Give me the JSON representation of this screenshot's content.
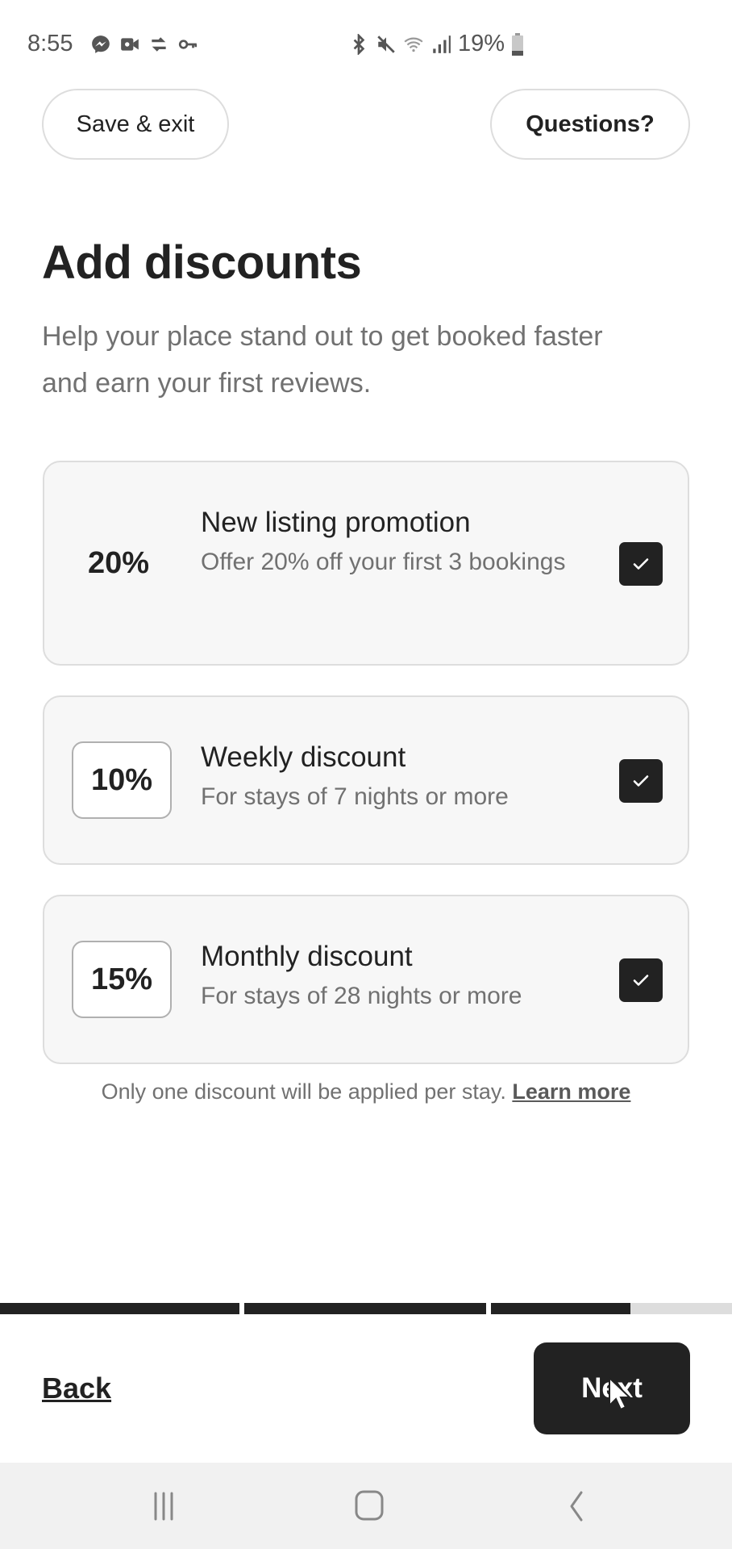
{
  "status_bar": {
    "time": "8:55",
    "left_icons": [
      "messenger-icon",
      "video-call-icon",
      "sync-icon",
      "vpn-key-icon"
    ],
    "right_icons": [
      "bluetooth-icon",
      "mute-icon",
      "wifi-icon",
      "signal-icon"
    ],
    "battery_text": "19%",
    "battery_level": 0.19
  },
  "header": {
    "save_exit_label": "Save & exit",
    "questions_label": "Questions?"
  },
  "page": {
    "title": "Add discounts",
    "subtitle": "Help your place stand out to get booked faster and earn your first reviews."
  },
  "discounts": [
    {
      "percent": "20%",
      "title": "New listing promotion",
      "description": "Offer 20% off your first 3 bookings",
      "checked": true,
      "editable": false
    },
    {
      "percent": "10%",
      "title": "Weekly discount",
      "description": "For stays of 7 nights or more",
      "checked": true,
      "editable": true
    },
    {
      "percent": "15%",
      "title": "Monthly discount",
      "description": "For stays of 28 nights or more",
      "checked": true,
      "editable": true
    }
  ],
  "footnote": {
    "text": "Only one discount will be applied per stay.",
    "link_label": "Learn more"
  },
  "progress": {
    "segments": 3,
    "segment_fill": [
      1.0,
      1.0,
      0.58
    ]
  },
  "footer": {
    "back_label": "Back",
    "next_label": "Next"
  },
  "nav_bar": {
    "buttons": [
      "recent-apps-icon",
      "home-icon",
      "back-icon"
    ]
  },
  "colors": {
    "primary_dark": "#222222",
    "secondary_text": "#717171",
    "card_bg": "#f7f7f7",
    "border": "#dddddd"
  }
}
